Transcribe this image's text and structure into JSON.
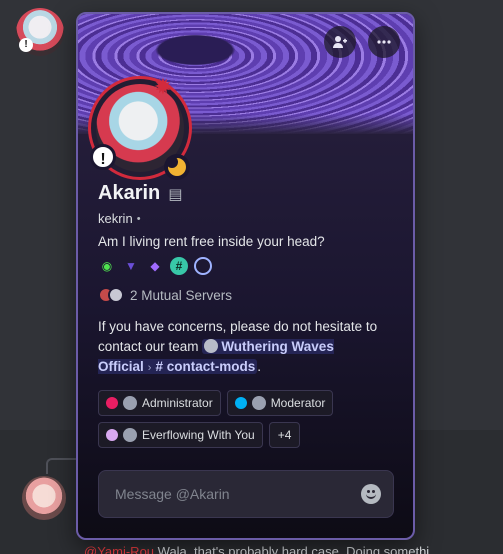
{
  "background": {
    "reply_snippet_mention": "@Yami-Rou",
    "reply_snippet_text": "Wala, that's probably hard case. Doing somethi"
  },
  "popout": {
    "display_name": "Akarin",
    "username": "kekrin",
    "bio": "Am I living rent free inside your head?",
    "status": "idle",
    "badges": [
      {
        "icon": "nitro-icon"
      },
      {
        "icon": "hypesquad-icon"
      },
      {
        "icon": "boost-gem-icon"
      },
      {
        "icon": "hashtag-badge-icon"
      },
      {
        "icon": "quest-badge-icon"
      }
    ],
    "mutual_servers": "2 Mutual Servers",
    "about_prefix": "If you have concerns, please do not hesitate to contact our team ",
    "about_server": "Wuthering Waves Official",
    "about_channel": "contact-mods",
    "about_suffix": ".",
    "roles": [
      {
        "name": "Administrator",
        "color": "#e91e63"
      },
      {
        "name": "Moderator",
        "color": "#00b0f4"
      },
      {
        "name": "Everflowing With You",
        "color": "#d8a8f0"
      }
    ],
    "more_roles": "+4",
    "message_placeholder": "Message @Akarin"
  },
  "colors": {
    "accent_border": "#6b5ca8",
    "avatar_ring": "#d22a3c",
    "idle": "#f0b232"
  }
}
